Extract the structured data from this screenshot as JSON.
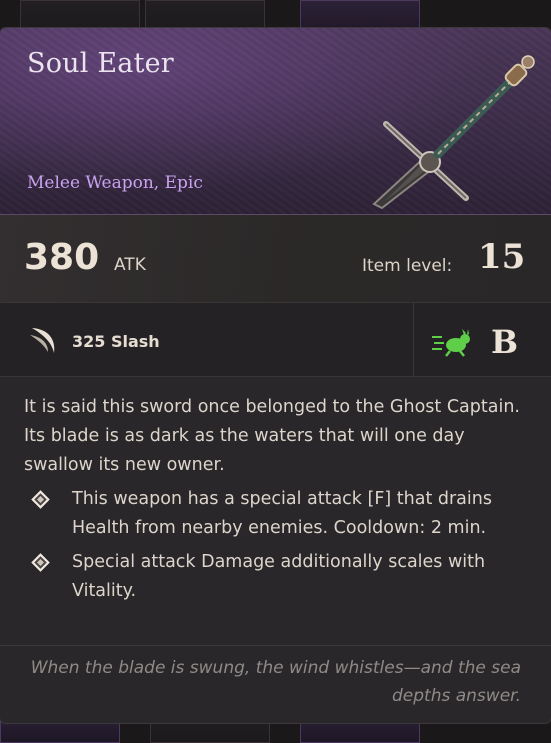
{
  "item": {
    "name": "Soul Eater",
    "type": "Melee Weapon, Epic",
    "icon": "sword-icon"
  },
  "stats": {
    "atk_value": "380",
    "atk_unit": "ATK",
    "item_level_label": "Item level:",
    "item_level_value": "15"
  },
  "damage": {
    "text": "325 Slash",
    "icon": "slash-icon",
    "speed_icon": "running-rabbit-icon",
    "speed_grade": "B"
  },
  "description": "It is said this sword once belonged to the Ghost Captain. Its blade is as dark as the waters that will one day swallow its new owner.",
  "bullets": [
    "This weapon has a special attack [F] that drains Health from nearby enemies. Cooldown: 2 min.",
    "Special attack Damage additionally scales with Vitality."
  ],
  "flavor": "When the blade is swung, the wind whistles—and the sea depths answer.",
  "colors": {
    "header": "#3e2d4b",
    "rarity_text": "#c9a3f0",
    "speed_icon": "#5fcf4a"
  }
}
